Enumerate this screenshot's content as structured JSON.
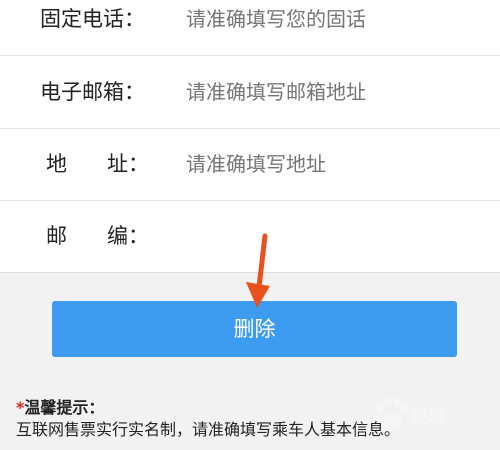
{
  "form": {
    "rows": [
      {
        "label": "固定电话：",
        "placeholder": "请准确填写您的固话"
      },
      {
        "label": "电子邮箱：",
        "placeholder": "请准确填写邮箱地址"
      },
      {
        "label_a": "地",
        "label_b": "址：",
        "placeholder": "请准确填写地址"
      },
      {
        "label_a": "邮",
        "label_b": "编：",
        "placeholder": ""
      }
    ]
  },
  "delete_button": {
    "label": "删除",
    "color": "#3d9bf0"
  },
  "annotation": {
    "color": "#e8501e",
    "icon": "arrow-down-icon"
  },
  "tips": {
    "star": "*",
    "title": "温馨提示：",
    "content": "互联网售票实行实名制，请准确填写乘车人基本信息。"
  },
  "watermark": {
    "text": "经验",
    "icon": "baidu-paw-icon"
  }
}
